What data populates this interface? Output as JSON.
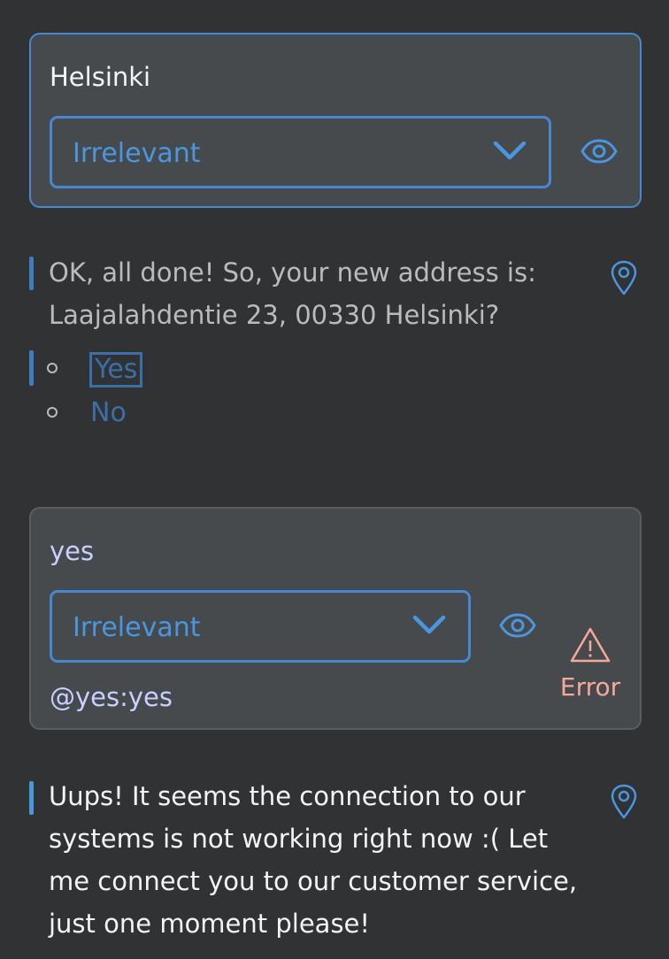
{
  "cards": [
    {
      "utterance": "Helsinki",
      "select_value": "Irrelevant"
    },
    {
      "utterance": "yes",
      "select_value": "Irrelevant",
      "intent_tag": "@yes:yes",
      "error_label": "Error"
    }
  ],
  "bot_messages": [
    {
      "text": "OK, all done! So, your new address is: Laajalahdentie 23, 00330 Helsinki?"
    },
    {
      "text": "Uups! It seems the connection to our systems is not working right now :( Let me connect you to our customer service, just one moment please!"
    }
  ],
  "options": [
    {
      "label": "Yes"
    },
    {
      "label": "No"
    }
  ],
  "icons": {
    "dropdown": "chevron-down-icon",
    "preview": "eye-icon",
    "location": "location-pin-icon",
    "warning": "warning-triangle-icon"
  },
  "colors": {
    "background": "#313233",
    "card": "#464a4c",
    "accent_blue": "#4589d4",
    "option_blue": "#3c6ea8",
    "utterance_lilac": "#c7d0ff",
    "error_salmon": "#f5a99b"
  }
}
